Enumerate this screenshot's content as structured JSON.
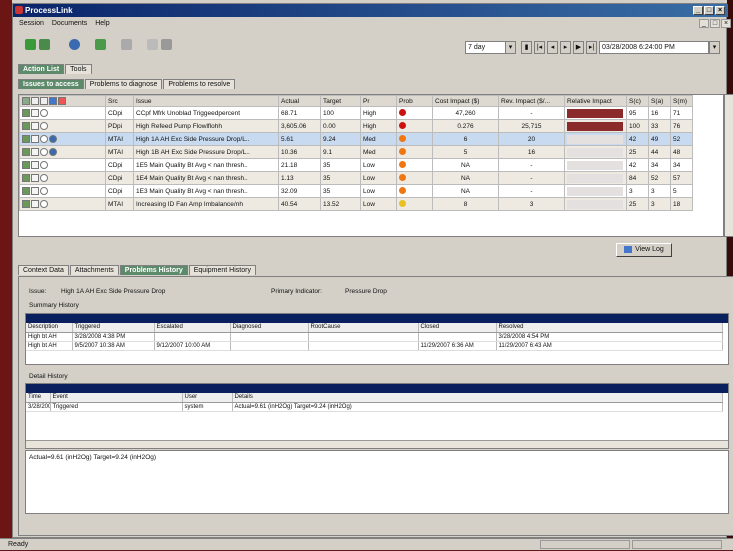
{
  "window": {
    "title": "ProcessLink"
  },
  "menu": [
    "Session",
    "Documents",
    "Help"
  ],
  "toolbar": {
    "interval": "7 day",
    "datetime": "03/28/2008 6:24:00 PM"
  },
  "top_tabs": [
    "Action List",
    "Tools"
  ],
  "sub_tabs": [
    "Issues to access",
    "Problems to diagnose",
    "Problems to resolve"
  ],
  "grid": {
    "columns": [
      "",
      "Src",
      "Issue",
      "Actual",
      "Target",
      "Pr",
      "Prob",
      "Cost Impact ($)",
      "Rev. Impact ($/...",
      "Relative Impact",
      "S(c)",
      "S(a)",
      "S(m)"
    ],
    "rows": [
      {
        "src": "CDpi",
        "issue": "CCpf Mfrk Unoblad Triggeedpercent",
        "actual": "68.71",
        "target": "100",
        "pr": "High",
        "prob": "#cc1111",
        "cost": "47,260",
        "rev": "-",
        "rel": 0.95,
        "sc": "95",
        "sa": "16",
        "sm": "71"
      },
      {
        "src": "PDpi",
        "issue": "High Refeed Pump Flowlflohh",
        "actual": "3,605.06",
        "target": "0.00",
        "pr": "High",
        "prob": "#cc1111",
        "cost": "0.276",
        "rev": "25,715",
        "rel": 0.9,
        "sc": "100",
        "sa": "33",
        "sm": "76"
      },
      {
        "src": "MTAI",
        "issue": "High 1A AH Exc Side Pressure Drop/L..",
        "actual": "5.61",
        "target": "9.24",
        "pr": "Med",
        "prob": "#ee7711",
        "cost": "6",
        "rev": "20",
        "rel": 0.0,
        "sc": "42",
        "sa": "49",
        "sm": "52"
      },
      {
        "src": "MTAI",
        "issue": "High 1B AH Exc Side Pressure Drop/L..",
        "actual": "10.36",
        "target": "9.1",
        "pr": "Med",
        "prob": "#ee7711",
        "cost": "5",
        "rev": "16",
        "rel": 0.0,
        "sc": "25",
        "sa": "44",
        "sm": "48"
      },
      {
        "src": "CDpi",
        "issue": "1E5 Main Quality Bt Avg < nan thresh..",
        "actual": "21.18",
        "target": "35",
        "pr": "Low",
        "prob": "#ee7711",
        "cost": "NA",
        "rev": "-",
        "rel": 0.0,
        "sc": "42",
        "sa": "34",
        "sm": "34"
      },
      {
        "src": "CDpi",
        "issue": "1E4 Main Quality Bt Avg < nan thresh..",
        "actual": "1.13",
        "target": "35",
        "pr": "Low",
        "prob": "#ee7711",
        "cost": "NA",
        "rev": "-",
        "rel": 0.0,
        "sc": "84",
        "sa": "52",
        "sm": "57"
      },
      {
        "src": "CDpi",
        "issue": "1E3 Main Quality Bt Avg < nan thresh..",
        "actual": "32.09",
        "target": "35",
        "pr": "Low",
        "prob": "#ee7711",
        "cost": "NA",
        "rev": "-",
        "rel": 0.0,
        "sc": "3",
        "sa": "3",
        "sm": "5"
      },
      {
        "src": "MTAI",
        "issue": "Increasing ID Fan Amp Imbalance/nh",
        "actual": "40.54",
        "target": "13.52",
        "pr": "Low",
        "prob": "#e8c020",
        "cost": "8",
        "rev": "3",
        "rel": 0.0,
        "sc": "25",
        "sa": "3",
        "sm": "18"
      }
    ]
  },
  "view_log": "View Log",
  "lower_tabs": [
    "Context Data",
    "Attachments",
    "Problems History",
    "Equipment History"
  ],
  "issue_line": {
    "issue_label": "Issue:",
    "issue_value": "High 1A AH Exc Side Pressure Drop",
    "ind_label": "Primary Indicator:",
    "ind_value": "Pressure Drop"
  },
  "summary": {
    "title": "Summary History",
    "columns": [
      "Description",
      "Triggered",
      "Escalated",
      "Diagnosed",
      "RootCause",
      "Closed",
      "Resolved"
    ],
    "rows": [
      [
        "High bt AH",
        "3/28/2008 4:38 PM",
        "",
        "",
        "",
        "",
        "3/28/2008 4:54 PM"
      ],
      [
        "High bt AH",
        "9/5/2007 10:38 AM",
        "9/12/2007 10:00 AM",
        "",
        "",
        "11/29/2007 6:36 AM",
        "11/29/2007 6:43 AM"
      ]
    ]
  },
  "detail": {
    "title": "Detail History",
    "columns": [
      "Time",
      "Event",
      "User",
      "Details"
    ],
    "rows": [
      [
        "3/28/2008 6:0",
        "Triggered",
        "system",
        "Actual=9.61 (inH2Og) Target=9.24 (inH2Og)"
      ]
    ]
  },
  "detail_text": "Actual=9.61 (inH2Og) Target=9.24 (inH2Og)",
  "status": "Ready"
}
